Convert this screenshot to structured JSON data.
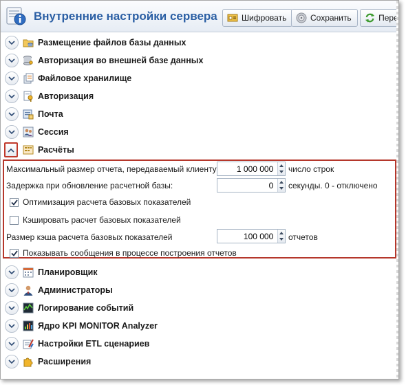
{
  "header": {
    "title": "Внутренние настройки сервера",
    "buttons": {
      "encrypt": "Шифровать",
      "save": "Сохранить",
      "more": "Перез"
    }
  },
  "sections_top": [
    {
      "label": "Размещение файлов базы данных",
      "icon": "folder-database-icon"
    },
    {
      "label": "Авторизация во внешней базе данных",
      "icon": "database-key-icon"
    },
    {
      "label": "Файловое хранилище",
      "icon": "file-storage-icon"
    },
    {
      "label": "Авторизация",
      "icon": "authorization-key-icon"
    },
    {
      "label": "Почта",
      "icon": "mail-icon"
    },
    {
      "label": "Сессия",
      "icon": "session-users-icon"
    },
    {
      "label": "Расчёты",
      "icon": "calculations-icon",
      "expanded": true
    }
  ],
  "calculations": {
    "max_report_label": "Максимальный размер отчета, передаваемый клиенту:",
    "max_report_value": "1 000 000",
    "max_report_unit": "число строк",
    "delay_label": "Задержка при обновление расчетной базы:",
    "delay_value": "0",
    "delay_unit": "секунды. 0 - отключено",
    "optimize_label": "Оптимизация расчета базовых показателей",
    "optimize_checked": true,
    "cache_label": "Кэшировать расчет базовых показателей",
    "cache_checked": false,
    "cache_size_label": "Размер кэша расчета базовых показателей",
    "cache_size_value": "100 000",
    "cache_size_unit": "отчетов",
    "show_messages_label": "Показывать сообщения в процессе построения отчетов",
    "show_messages_checked": true
  },
  "sections_bottom": [
    {
      "label": "Планировщик",
      "icon": "scheduler-icon"
    },
    {
      "label": "Администраторы",
      "icon": "administrator-icon"
    },
    {
      "label": "Логирование событий",
      "icon": "event-log-icon"
    },
    {
      "label": "Ядро KPI MONITOR Analyzer",
      "icon": "analyzer-core-icon"
    },
    {
      "label": "Настройки ETL сценариев",
      "icon": "etl-scenarios-icon"
    },
    {
      "label": "Расширения",
      "icon": "extensions-puzzle-icon"
    }
  ],
  "colors": {
    "title": "#2b5fa4",
    "highlight_border": "#b5372b"
  }
}
